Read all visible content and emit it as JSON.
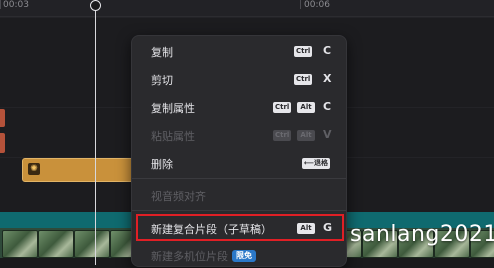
{
  "timeline": {
    "ruler_labels": [
      "00:03",
      "00:06"
    ]
  },
  "clip": {
    "icon": "audio-clip-icon"
  },
  "context_menu": {
    "items": [
      {
        "label": "复制",
        "keys": [
          "Ctrl"
        ],
        "letter": "C",
        "disabled": false
      },
      {
        "label": "剪切",
        "keys": [
          "Ctrl"
        ],
        "letter": "X",
        "disabled": false
      },
      {
        "label": "复制属性",
        "keys": [
          "Ctrl",
          "Alt"
        ],
        "letter": "C",
        "disabled": false
      },
      {
        "label": "粘贴属性",
        "keys": [
          "Ctrl",
          "Alt"
        ],
        "letter": "V",
        "disabled": true
      },
      {
        "label": "删除",
        "keys": [
          "⟵退格"
        ],
        "letter": "",
        "disabled": false
      },
      {
        "label": "视音频对齐",
        "keys": [],
        "letter": "",
        "disabled": true
      },
      {
        "label": "新建复合片段（子草稿）",
        "keys": [
          "Alt"
        ],
        "letter": "G",
        "disabled": false
      },
      {
        "label": "新建多机位片段",
        "badge": "限免",
        "keys": [],
        "letter": "",
        "disabled": true
      }
    ],
    "highlight_color": "#e01f25"
  },
  "watermark": "sanlang2021"
}
